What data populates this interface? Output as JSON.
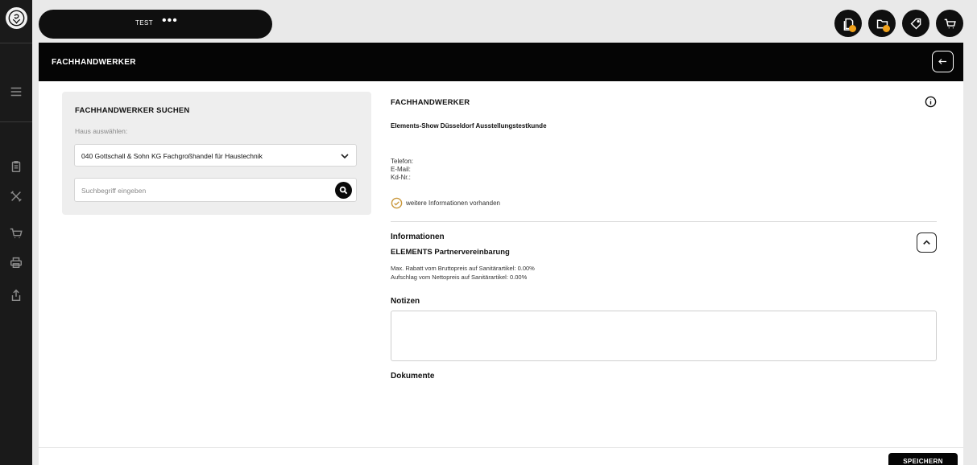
{
  "topbar": {
    "title": "TEST",
    "more": "•••"
  },
  "header": {
    "title": "FACHHANDWERKER"
  },
  "search": {
    "heading": "FACHHANDWERKER SUCHEN",
    "house_label": "Haus auswählen:",
    "house_value": "040 Gottschall & Sohn KG Fachgroßhandel für Haustechnik",
    "placeholder": "Suchbegriff eingeben"
  },
  "detail": {
    "heading": "FACHHANDWERKER",
    "name": "Elements-Show Düsseldorf Ausstellungstestkunde",
    "phone_label": "Telefon:",
    "email_label": "E-Mail:",
    "customer_no_label": "Kd-Nr.:",
    "more_info": "weitere Informationen vorhanden",
    "info_heading": "Informationen",
    "partner_heading": "ELEMENTS Partnervereinbarung",
    "partner_lines": [
      "Max. Rabatt vom Bruttopreis auf Sanitärartikel: 0.00%",
      "Aufschlag vom Nettopreis auf Sanitärartikel: 0.00%"
    ],
    "notes_heading": "Notizen",
    "documents_heading": "Dokumente"
  },
  "footer": {
    "save_label": "SPEICHERN"
  },
  "colors": {
    "accent": "#f0a11a",
    "check": "#c9973a",
    "rail": "#1a1a1a"
  },
  "icons": {
    "rail": [
      "menu-icon",
      "clipboard-icon",
      "tools-icon",
      "cart-icon",
      "printer-icon",
      "share-icon"
    ],
    "top": [
      "documents-icon",
      "folder-icon",
      "tag-icon",
      "cart-icon"
    ]
  }
}
